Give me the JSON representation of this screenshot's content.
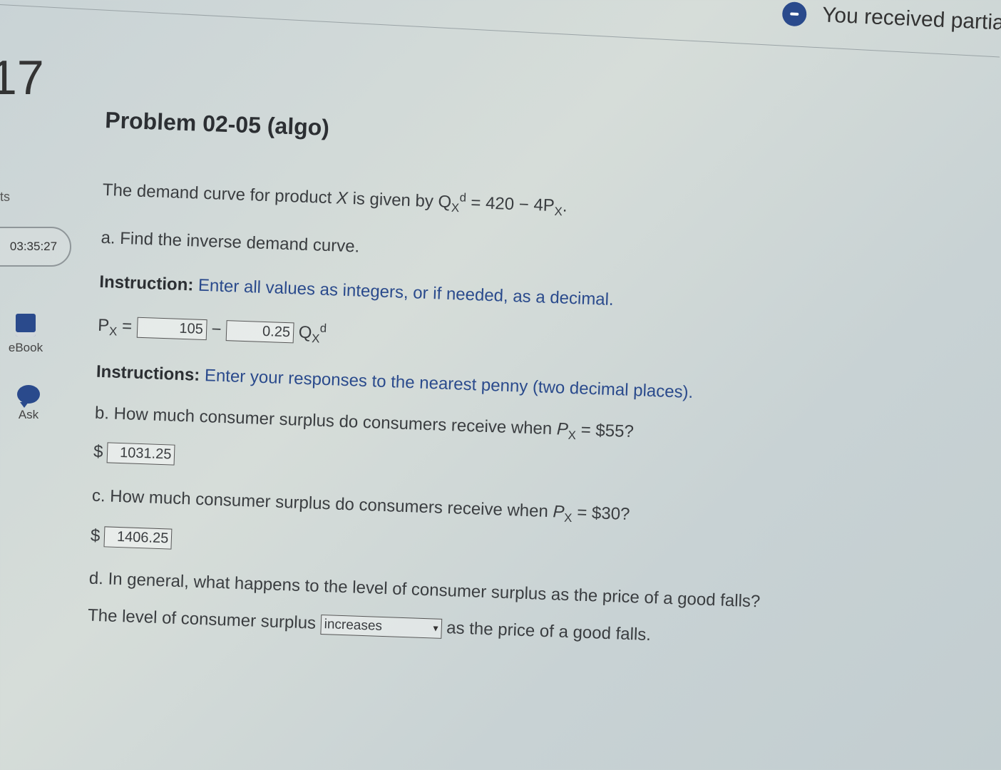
{
  "notice": {
    "text": "You received partia"
  },
  "left_rail": {
    "question_number": "17",
    "points_label": "ts",
    "timer": "03:35:27",
    "ebook_label": "eBook",
    "ask_label": "Ask"
  },
  "problem": {
    "title": "Problem 02-05 (algo)",
    "intro": {
      "text": "The demand curve for product ",
      "var": "X",
      "given": " is given by ",
      "eq_lhs": "Q",
      "eq_sub": "X",
      "eq_sup": "d",
      "eq_rhs": " = 420 − 4P",
      "eq_rhs_sub": "X",
      "end": "."
    },
    "part_a": {
      "question": "a. Find the inverse demand curve.",
      "instruction_bold": "Instruction:",
      "instruction_text": " Enter all values as integers, or if needed, as a decimal.",
      "lhs": "P",
      "lhs_sub": "X",
      "equals": " = ",
      "answer1": "105",
      "minus": " − ",
      "answer2": "0.25",
      "q": " Q",
      "q_sub": "X",
      "q_sup": "d"
    },
    "instructions2": {
      "bold": "Instructions:",
      "text": " Enter your responses to the nearest penny (two decimal places)."
    },
    "part_b": {
      "question": "b. How much consumer surplus do consumers receive when ",
      "var": "P",
      "var_sub": "X",
      "tail": " = $55?",
      "currency": "$",
      "answer": "1031.25"
    },
    "part_c": {
      "question": "c. How much consumer surplus do consumers receive when ",
      "var": "P",
      "var_sub": "X",
      "tail": " = $30?",
      "currency": "$",
      "answer": "1406.25"
    },
    "part_d": {
      "question": "d. In general, what happens to the level of consumer surplus as the price of a good falls?",
      "prefix": "The level of consumer surplus ",
      "selected": "increases",
      "suffix": " as the price of a good falls."
    }
  }
}
